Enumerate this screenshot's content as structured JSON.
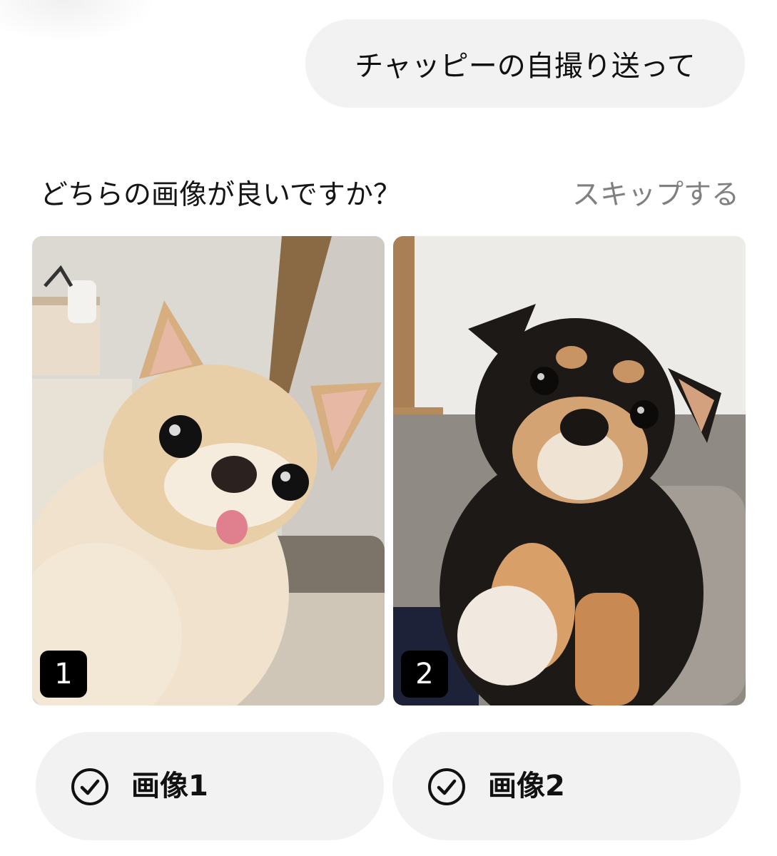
{
  "chat": {
    "user_message": "チャッピーの自撮り送って"
  },
  "prompt": {
    "question": "どちらの画像が良いですか？",
    "skip_label": "スキップする"
  },
  "images": [
    {
      "number": "1",
      "alt": "chihuahua selfie"
    },
    {
      "number": "2",
      "alt": "black and tan dog"
    }
  ],
  "choices": [
    {
      "label": "画像1",
      "icon": "check-circle-icon"
    },
    {
      "label": "画像2",
      "icon": "check-circle-icon"
    }
  ],
  "colors": {
    "bubble_bg": "#f2f2f2",
    "skip_text": "#808080",
    "badge_bg": "#000000"
  }
}
